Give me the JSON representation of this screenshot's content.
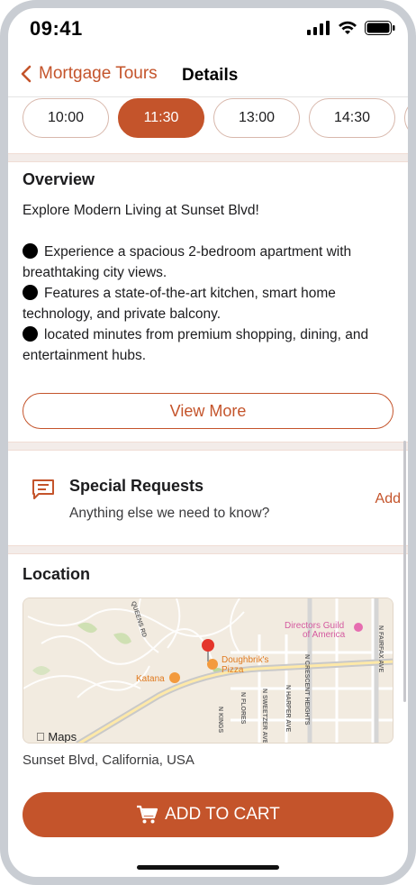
{
  "status_bar": {
    "time": "09:41",
    "icons": [
      "signal-icon",
      "wifi-icon",
      "battery-icon"
    ]
  },
  "nav": {
    "back_label": "Mortgage Tours",
    "title": "Details"
  },
  "time_slots": {
    "options": [
      "10:00",
      "11:30",
      "13:00",
      "14:30"
    ],
    "selected": "11:30"
  },
  "overview": {
    "heading": "Overview",
    "intro": "Explore Modern Living at Sunset Blvd!",
    "bullets": [
      "Experience a spacious 2-bedroom apartment with breathtaking city views.",
      "Features a state-of-the-art kitchen, smart home technology, and private balcony.",
      "located minutes from premium shopping, dining, and entertainment hubs."
    ],
    "view_more": "View More"
  },
  "requests": {
    "title": "Special Requests",
    "subtitle": "Anything else we need to know?",
    "action": "Add"
  },
  "location": {
    "heading": "Location",
    "address": "Sunset Blvd, California, USA",
    "map": {
      "places": [
        "Doughbrik's Pizza",
        "Katana",
        "Directors Guild of America"
      ],
      "streets": [
        "QUEENS RD",
        "N FAIRFAX AVE",
        "N CRESCENT HEIGHTS",
        "N SWEETZER AVE",
        "N HARPER AVE",
        "N FLORES",
        "N KINGS"
      ],
      "brand": "Maps"
    }
  },
  "cart": {
    "label": "ADD TO CART"
  },
  "colors": {
    "accent": "#c4542b",
    "accent_border": "#d8b8ac",
    "separator": "#f3ece9"
  }
}
